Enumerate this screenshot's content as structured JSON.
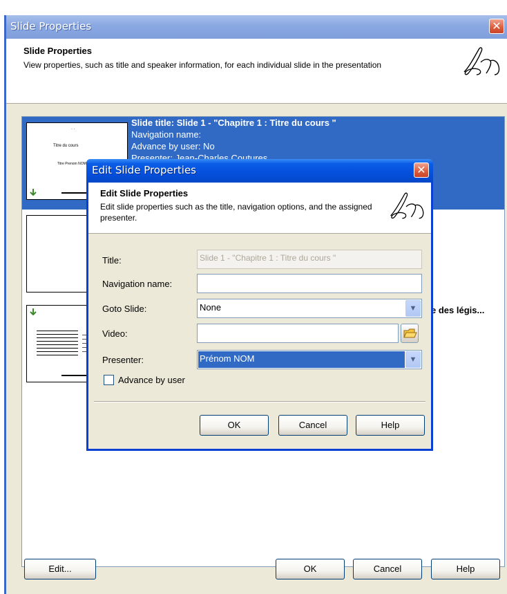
{
  "outer_window": {
    "title": "Slide Properties",
    "close_glyph": "✕",
    "header_title": "Slide Properties",
    "header_desc": "View properties, such as title and speaker information, for each individual slide in the presentation",
    "buttons": {
      "edit": "Edit...",
      "ok": "OK",
      "cancel": "Cancel",
      "help": "Help"
    }
  },
  "slides": [
    {
      "title_line": "Slide title: Slide 1 - \"Chapitre 1 : Titre du cours \"",
      "navigation": "Navigation name:",
      "advance": "Advance by user: No",
      "presenter": "Presenter: Jean-Charles Coutures",
      "thumb_text_1": "Titre du cours",
      "thumb_text_2": "Titre Prenom NOM"
    },
    {
      "title_line": ""
    },
    {
      "title_fragment": "e des légis..."
    }
  ],
  "dialog": {
    "title": "Edit Slide Properties",
    "close_glyph": "✕",
    "header_title": "Edit Slide Properties",
    "header_desc": "Edit slide properties such as the title, navigation options, and the assigned presenter.",
    "fields": {
      "title_label": "Title:",
      "title_value": "Slide 1 - \"Chapitre 1 : Titre du cours \"",
      "nav_label": "Navigation name:",
      "nav_value": "",
      "goto_label": "Goto Slide:",
      "goto_value": "None",
      "video_label": "Video:",
      "video_value": "",
      "presenter_label": "Presenter:",
      "presenter_value": "Prénom NOM",
      "advance_label": "Advance by user",
      "advance_checked": false
    },
    "buttons": {
      "ok": "OK",
      "cancel": "Cancel",
      "help": "Help"
    }
  },
  "icons": {
    "close": "close-icon",
    "dropdown": "chevron-down-icon",
    "browse": "folder-open-icon",
    "logo": "brand-logo-icon",
    "transition": "transition-arrow-icon"
  },
  "colors": {
    "selection": "#316ac5",
    "outer_titlebar": "#8aa8e2",
    "dialog_titlebar": "#0550dc",
    "window_bg": "#ece9d8",
    "close_button": "#dc5b3a"
  }
}
